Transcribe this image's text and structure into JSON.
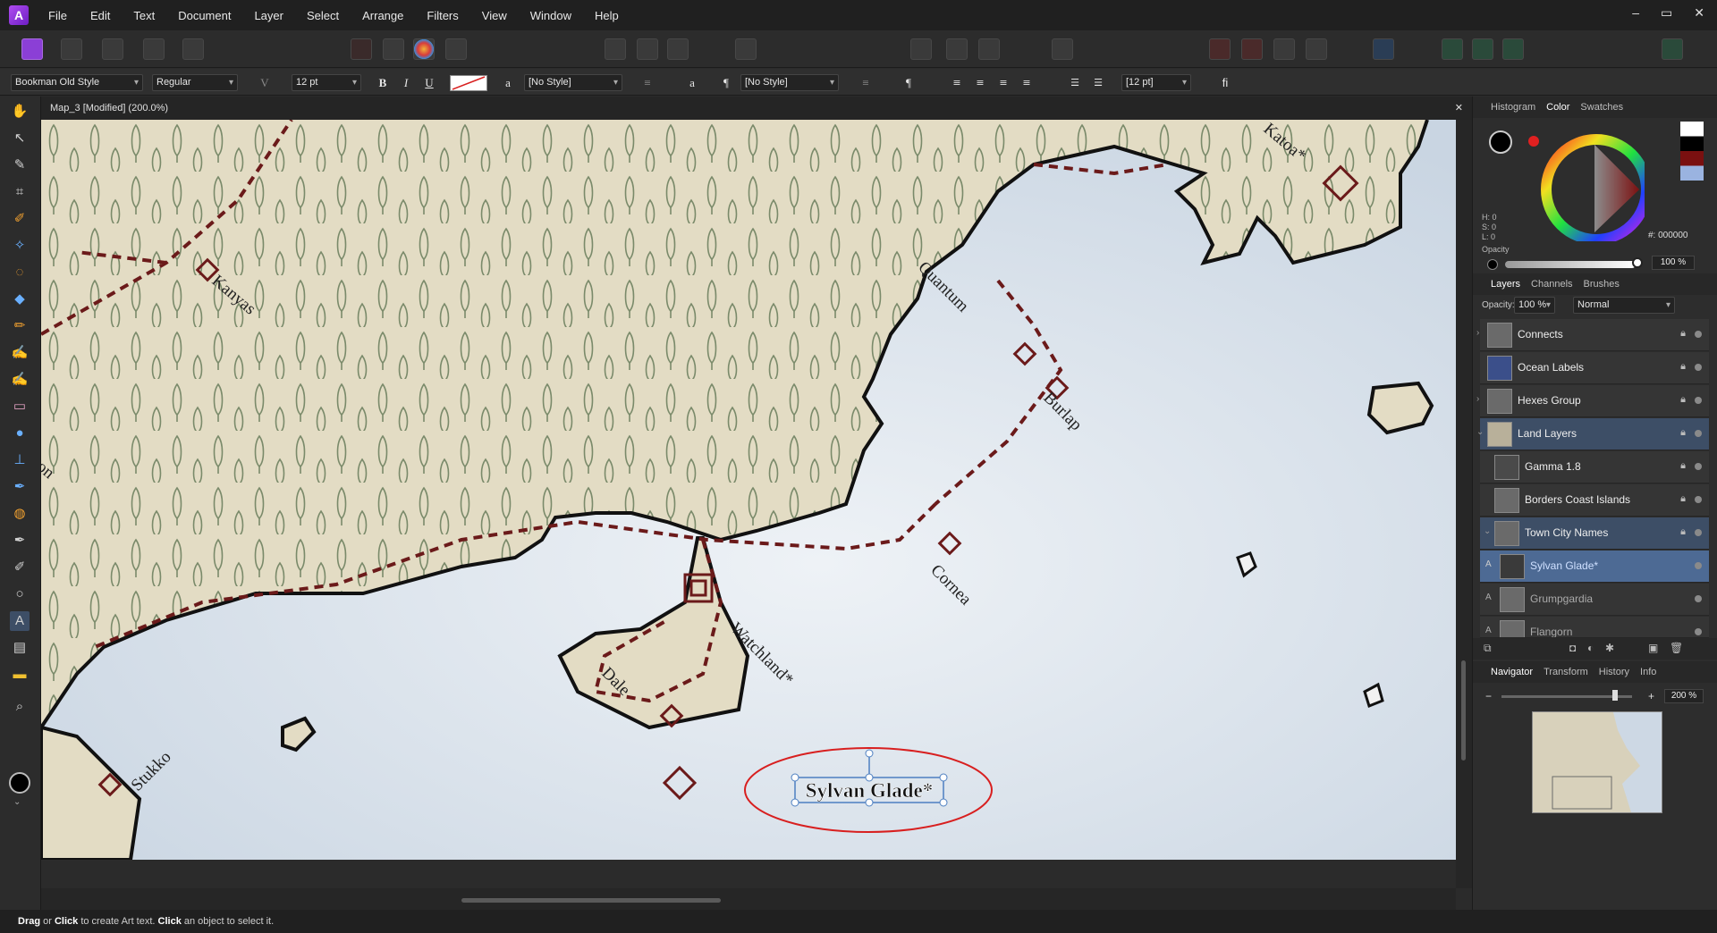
{
  "app": {
    "logo": "A"
  },
  "menu": [
    "File",
    "Edit",
    "Text",
    "Document",
    "Layer",
    "Select",
    "Arrange",
    "Filters",
    "View",
    "Window",
    "Help"
  ],
  "window_controls": [
    "–",
    "▭",
    "✕"
  ],
  "context": {
    "font_family": "Bookman Old Style",
    "font_style": "Regular",
    "font_size": "12 pt",
    "bold": "B",
    "italic": "I",
    "underline": "U",
    "char_style_icon": "a",
    "char_style": "[No Style]",
    "para_icon_small": "a",
    "para_mark": "¶",
    "para_style": "[No Style]",
    "para_mark2": "¶",
    "leading": "[12 pt]",
    "ligature": "fi"
  },
  "document": {
    "title": "Map_3 [Modified] (200.0%)",
    "close": "✕"
  },
  "map": {
    "labels": [
      "Kanyas",
      "Quantum",
      "Burlap",
      "Cornea",
      "Watchland*",
      "Dale",
      "Stukko",
      "Katoa*",
      "on"
    ],
    "selected_text": "Sylvan Glade*"
  },
  "status": {
    "b1": "Drag",
    "t1": " or ",
    "b2": "Click",
    "t2": " to create Art text. ",
    "b3": "Click",
    "t3": " an object to select it."
  },
  "panels": {
    "color_tabs": [
      "Histogram",
      "Color",
      "Swatches"
    ],
    "hsl": {
      "h": "H: 0",
      "s": "S: 0",
      "l": "L: 0"
    },
    "hex": "000000",
    "opacity_label": "Opacity",
    "opacity_value": "100 %",
    "layer_tabs": [
      "Layers",
      "Channels",
      "Brushes"
    ],
    "layer_opacity_label": "Opacity:",
    "layer_opacity": "100 %",
    "blend_mode": "Normal",
    "layers": [
      {
        "name": "Connects",
        "selected": false
      },
      {
        "name": "Ocean Labels",
        "selected": false
      },
      {
        "name": "Hexes Group",
        "selected": false
      },
      {
        "name": "Land Layers",
        "selected": true
      },
      {
        "name": "Gamma 1.8",
        "selected": false
      },
      {
        "name": "Borders Coast Islands",
        "selected": false
      },
      {
        "name": "Town City Names",
        "selected": true
      },
      {
        "name": "Sylvan Glade*",
        "selected": true
      },
      {
        "name": "Grumpgardia",
        "selected": false
      },
      {
        "name": "Flangorn",
        "selected": false
      }
    ],
    "nav_tabs": [
      "Navigator",
      "Transform",
      "History",
      "Info"
    ],
    "zoom": "200 %"
  },
  "colors": {
    "accent": "#4d7fc1",
    "map_border": "#6b1a1a",
    "land": "#e3dcc4",
    "sea": "#e6ecf2",
    "selection_circle": "#d81f1f"
  }
}
